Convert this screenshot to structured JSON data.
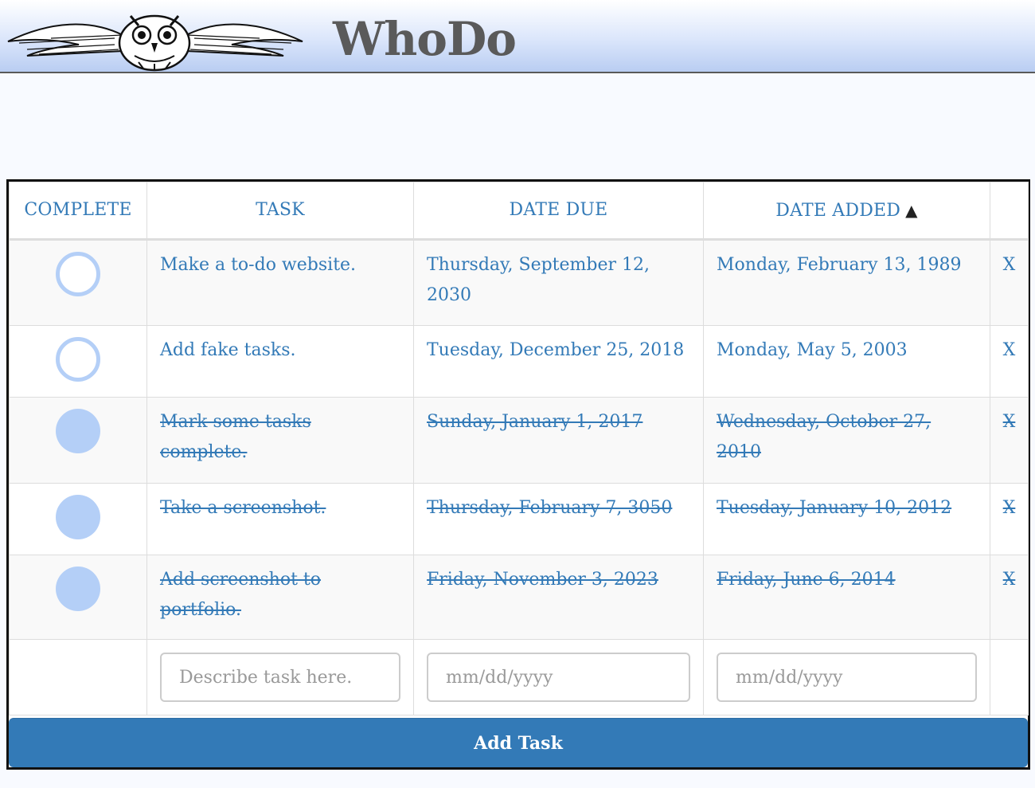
{
  "app": {
    "title": "WhoDo"
  },
  "table": {
    "headers": {
      "complete": "COMPLETE",
      "task": "TASK",
      "date_due": "DATE DUE",
      "date_added": "DATE ADDED",
      "sort_indicator": "▲"
    },
    "rows": [
      {
        "complete": false,
        "task": "Make a to-do website.",
        "date_due": "Thursday, September 12, 2030",
        "date_added": "Monday, February 13, 1989",
        "delete": "X"
      },
      {
        "complete": false,
        "task": "Add fake tasks.",
        "date_due": "Tuesday, December 25, 2018",
        "date_added": "Monday, May 5, 2003",
        "delete": "X"
      },
      {
        "complete": true,
        "task": "Mark some tasks complete.",
        "date_due": "Sunday, January 1, 2017",
        "date_added": "Wednesday, October 27, 2010",
        "delete": "X"
      },
      {
        "complete": true,
        "task": "Take a screenshot.",
        "date_due": "Thursday, February 7, 3050",
        "date_added": "Tuesday, January 10, 2012",
        "delete": "X"
      },
      {
        "complete": true,
        "task": "Add screenshot to portfolio.",
        "date_due": "Friday, November 3, 2023",
        "date_added": "Friday, June 6, 2014",
        "delete": "X"
      }
    ]
  },
  "form": {
    "task_placeholder": "Describe task here.",
    "date_due_placeholder": "mm/dd/yyyy",
    "date_added_placeholder": "mm/dd/yyyy",
    "submit_label": "Add Task"
  },
  "colors": {
    "accent": "#337ab7",
    "complete_circle": "#b4cff7",
    "title": "#5a5a5a"
  }
}
